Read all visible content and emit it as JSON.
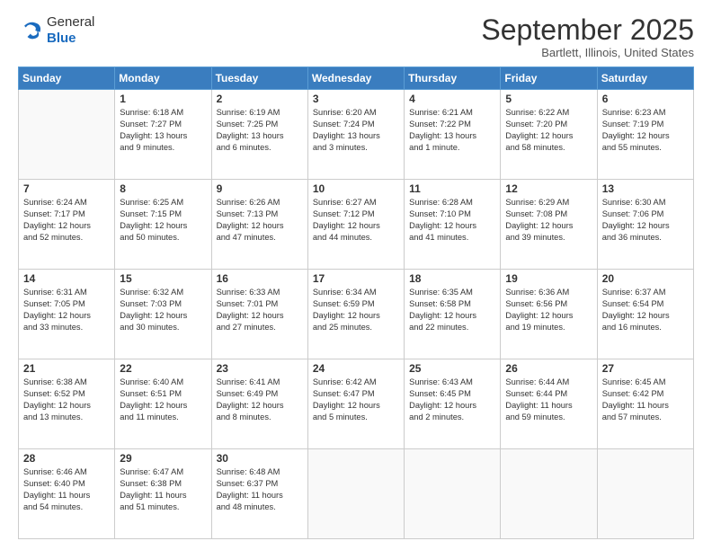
{
  "logo": {
    "general": "General",
    "blue": "Blue"
  },
  "header": {
    "month": "September 2025",
    "location": "Bartlett, Illinois, United States"
  },
  "weekdays": [
    "Sunday",
    "Monday",
    "Tuesday",
    "Wednesday",
    "Thursday",
    "Friday",
    "Saturday"
  ],
  "weeks": [
    [
      null,
      {
        "day": "1",
        "sunrise": "6:18 AM",
        "sunset": "7:27 PM",
        "daylight": "13 hours and 9 minutes."
      },
      {
        "day": "2",
        "sunrise": "6:19 AM",
        "sunset": "7:25 PM",
        "daylight": "13 hours and 6 minutes."
      },
      {
        "day": "3",
        "sunrise": "6:20 AM",
        "sunset": "7:24 PM",
        "daylight": "13 hours and 3 minutes."
      },
      {
        "day": "4",
        "sunrise": "6:21 AM",
        "sunset": "7:22 PM",
        "daylight": "13 hours and 1 minute."
      },
      {
        "day": "5",
        "sunrise": "6:22 AM",
        "sunset": "7:20 PM",
        "daylight": "12 hours and 58 minutes."
      },
      {
        "day": "6",
        "sunrise": "6:23 AM",
        "sunset": "7:19 PM",
        "daylight": "12 hours and 55 minutes."
      }
    ],
    [
      {
        "day": "7",
        "sunrise": "6:24 AM",
        "sunset": "7:17 PM",
        "daylight": "12 hours and 52 minutes."
      },
      {
        "day": "8",
        "sunrise": "6:25 AM",
        "sunset": "7:15 PM",
        "daylight": "12 hours and 50 minutes."
      },
      {
        "day": "9",
        "sunrise": "6:26 AM",
        "sunset": "7:13 PM",
        "daylight": "12 hours and 47 minutes."
      },
      {
        "day": "10",
        "sunrise": "6:27 AM",
        "sunset": "7:12 PM",
        "daylight": "12 hours and 44 minutes."
      },
      {
        "day": "11",
        "sunrise": "6:28 AM",
        "sunset": "7:10 PM",
        "daylight": "12 hours and 41 minutes."
      },
      {
        "day": "12",
        "sunrise": "6:29 AM",
        "sunset": "7:08 PM",
        "daylight": "12 hours and 39 minutes."
      },
      {
        "day": "13",
        "sunrise": "6:30 AM",
        "sunset": "7:06 PM",
        "daylight": "12 hours and 36 minutes."
      }
    ],
    [
      {
        "day": "14",
        "sunrise": "6:31 AM",
        "sunset": "7:05 PM",
        "daylight": "12 hours and 33 minutes."
      },
      {
        "day": "15",
        "sunrise": "6:32 AM",
        "sunset": "7:03 PM",
        "daylight": "12 hours and 30 minutes."
      },
      {
        "day": "16",
        "sunrise": "6:33 AM",
        "sunset": "7:01 PM",
        "daylight": "12 hours and 27 minutes."
      },
      {
        "day": "17",
        "sunrise": "6:34 AM",
        "sunset": "6:59 PM",
        "daylight": "12 hours and 25 minutes."
      },
      {
        "day": "18",
        "sunrise": "6:35 AM",
        "sunset": "6:58 PM",
        "daylight": "12 hours and 22 minutes."
      },
      {
        "day": "19",
        "sunrise": "6:36 AM",
        "sunset": "6:56 PM",
        "daylight": "12 hours and 19 minutes."
      },
      {
        "day": "20",
        "sunrise": "6:37 AM",
        "sunset": "6:54 PM",
        "daylight": "12 hours and 16 minutes."
      }
    ],
    [
      {
        "day": "21",
        "sunrise": "6:38 AM",
        "sunset": "6:52 PM",
        "daylight": "12 hours and 13 minutes."
      },
      {
        "day": "22",
        "sunrise": "6:40 AM",
        "sunset": "6:51 PM",
        "daylight": "12 hours and 11 minutes."
      },
      {
        "day": "23",
        "sunrise": "6:41 AM",
        "sunset": "6:49 PM",
        "daylight": "12 hours and 8 minutes."
      },
      {
        "day": "24",
        "sunrise": "6:42 AM",
        "sunset": "6:47 PM",
        "daylight": "12 hours and 5 minutes."
      },
      {
        "day": "25",
        "sunrise": "6:43 AM",
        "sunset": "6:45 PM",
        "daylight": "12 hours and 2 minutes."
      },
      {
        "day": "26",
        "sunrise": "6:44 AM",
        "sunset": "6:44 PM",
        "daylight": "11 hours and 59 minutes."
      },
      {
        "day": "27",
        "sunrise": "6:45 AM",
        "sunset": "6:42 PM",
        "daylight": "11 hours and 57 minutes."
      }
    ],
    [
      {
        "day": "28",
        "sunrise": "6:46 AM",
        "sunset": "6:40 PM",
        "daylight": "11 hours and 54 minutes."
      },
      {
        "day": "29",
        "sunrise": "6:47 AM",
        "sunset": "6:38 PM",
        "daylight": "11 hours and 51 minutes."
      },
      {
        "day": "30",
        "sunrise": "6:48 AM",
        "sunset": "6:37 PM",
        "daylight": "11 hours and 48 minutes."
      },
      null,
      null,
      null,
      null
    ]
  ],
  "labels": {
    "sunrise_prefix": "Sunrise: ",
    "sunset_prefix": "Sunset: ",
    "daylight_prefix": "Daylight: "
  }
}
